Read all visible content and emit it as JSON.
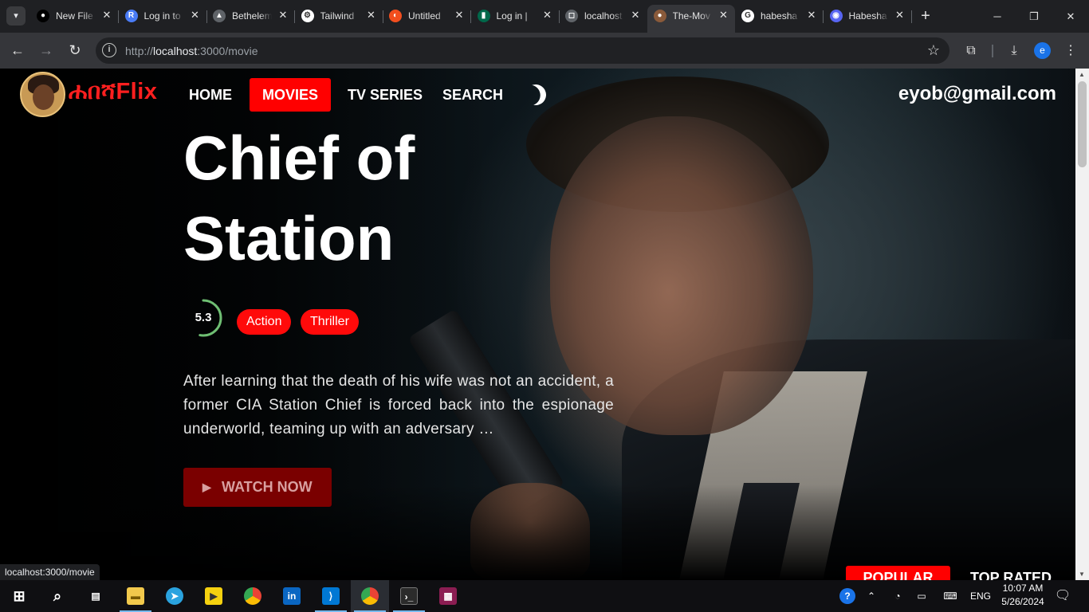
{
  "browser": {
    "tabs": [
      {
        "title": "New File",
        "icon": "github-icon",
        "color": "#000000",
        "glyph": "●"
      },
      {
        "title": "Log in to",
        "icon": "render-icon",
        "color": "#4a7cf7",
        "glyph": "R"
      },
      {
        "title": "Bethelem",
        "icon": "folder-icon",
        "color": "#5f6368",
        "glyph": "▲"
      },
      {
        "title": "Tailwind",
        "icon": "openai-icon",
        "color": "#ffffff",
        "glyph": "⚙"
      },
      {
        "title": "Untitled",
        "icon": "figma-icon",
        "color": "#f24e1e",
        "glyph": "◐"
      },
      {
        "title": "Log in |",
        "icon": "mongodb-icon",
        "color": "#00684a",
        "glyph": "▮"
      },
      {
        "title": "localhost",
        "icon": "page-icon",
        "color": "#5f6368",
        "glyph": "◻"
      },
      {
        "title": "The-Mov",
        "icon": "habesha-avatar-icon",
        "color": "#8a5a3a",
        "glyph": "●"
      },
      {
        "title": "habesha",
        "icon": "google-icon",
        "color": "#ffffff",
        "glyph": "G"
      },
      {
        "title": "Habesha",
        "icon": "discord-icon",
        "color": "#5865f2",
        "glyph": "◉"
      }
    ],
    "url_prefix": "http://",
    "url_host": "localhost",
    "url_path": ":3000/movie",
    "profile_initial": "e",
    "status_url": "localhost:3000/movie"
  },
  "site": {
    "logo_text": "ሐበሻFlix",
    "nav": [
      {
        "label": "HOME",
        "active": false
      },
      {
        "label": "MOVIES",
        "active": true
      },
      {
        "label": "TV SERIES",
        "active": false
      },
      {
        "label": "SEARCH",
        "active": false
      }
    ],
    "user_email": "eyob@gmail.com"
  },
  "hero": {
    "title": "Chief of Station",
    "rating": "5.3",
    "rating_fraction": 0.53,
    "rating_color": "#6fbf73",
    "genres": [
      "Action",
      "Thriller"
    ],
    "overview": "After learning that the death of his wife was not an accident, a former CIA Station Chief is forced back into the espionage underworld, teaming up with an adversary …",
    "watch_label": "WATCH NOW",
    "accent_color": "#ff0000"
  },
  "sections": {
    "popular_label": "POPULAR",
    "top_rated_label": "TOP RATED"
  },
  "taskbar": {
    "apps": [
      "file-explorer-icon",
      "telegram-icon",
      "media-player-icon",
      "chrome-icon",
      "linkedin-icon",
      "vscode-icon",
      "chrome-profile-icon",
      "terminal-icon",
      "winrar-icon"
    ],
    "language": "ENG",
    "time": "10:07 AM",
    "date": "5/26/2024"
  }
}
